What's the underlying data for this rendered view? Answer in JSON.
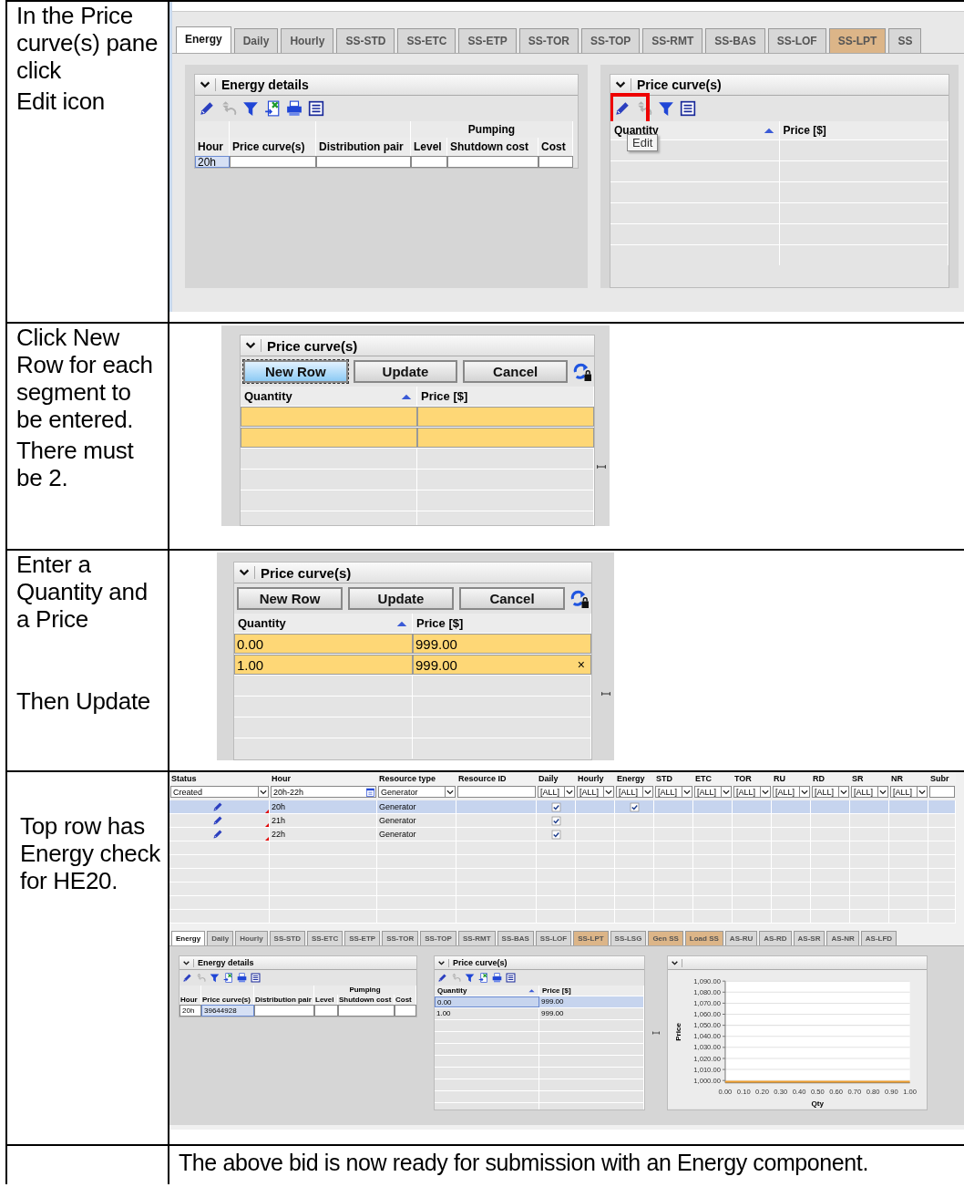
{
  "edit_step": {
    "instruction": [
      "In the Price curve(s) pane click",
      "Edit icon"
    ],
    "tabs": [
      {
        "label": "Energy",
        "selected": true,
        "highlighted": false
      },
      {
        "label": "Daily",
        "selected": false,
        "highlighted": false
      },
      {
        "label": "Hourly",
        "selected": false,
        "highlighted": false
      },
      {
        "label": "SS-STD",
        "selected": false,
        "highlighted": false
      },
      {
        "label": "SS-ETC",
        "selected": false,
        "highlighted": false
      },
      {
        "label": "SS-ETP",
        "selected": false,
        "highlighted": false
      },
      {
        "label": "SS-TOR",
        "selected": false,
        "highlighted": false
      },
      {
        "label": "SS-TOP",
        "selected": false,
        "highlighted": false
      },
      {
        "label": "SS-RMT",
        "selected": false,
        "highlighted": false
      },
      {
        "label": "SS-BAS",
        "selected": false,
        "highlighted": false
      },
      {
        "label": "SS-LOF",
        "selected": false,
        "highlighted": false
      },
      {
        "label": "SS-LPT",
        "selected": false,
        "highlighted": true
      },
      {
        "label": "SS",
        "selected": false,
        "highlighted": false
      }
    ],
    "energy_details": {
      "title": "Energy details",
      "group_header": "Pumping",
      "columns": [
        "Hour",
        "Price curve(s)",
        "Distribution pair",
        "Level",
        "Shutdown cost",
        "Cost"
      ],
      "rows": [
        {
          "cells": [
            "20h"
          ],
          "selected": true
        }
      ]
    },
    "price_curves": {
      "title": "Price curve(s)",
      "columns": [
        {
          "label": "Quantity",
          "sorted": true
        },
        {
          "label": "Price [$]",
          "sorted": false
        }
      ],
      "tooltip": "Edit",
      "edit_icon_marked": true
    }
  },
  "new_row_step": {
    "instruction": [
      "Click New Row for each segment to be entered.",
      "There must be 2."
    ],
    "panel": {
      "title": "Price curve(s)",
      "buttons": [
        {
          "label": "New Row",
          "focused": true
        },
        {
          "label": "Update",
          "focused": false
        },
        {
          "label": "Cancel",
          "focused": false
        }
      ],
      "columns": [
        {
          "label": "Quantity",
          "sorted": true
        },
        {
          "label": "Price [$]",
          "sorted": false
        }
      ],
      "rows": [
        {
          "editing": true
        },
        {
          "editing": true
        }
      ]
    }
  },
  "enter_step": {
    "instruction": [
      "Enter a Quantity and a Price",
      "Then Update"
    ],
    "panel": {
      "title": "Price curve(s)",
      "buttons": [
        {
          "label": "New Row",
          "focused": false
        },
        {
          "label": "Update",
          "focused": false
        },
        {
          "label": "Cancel",
          "focused": false
        }
      ],
      "columns": [
        {
          "label": "Quantity",
          "sorted": true
        },
        {
          "label": "Price [$]",
          "sorted": false
        }
      ],
      "rows": [
        {
          "cells": [
            "0.00",
            "999.00"
          ],
          "editing": true
        },
        {
          "cells": [
            "1.00",
            "999.00"
          ],
          "editing": true,
          "clear": "×"
        }
      ]
    }
  },
  "result_step": {
    "instruction": [
      "Top row has Energy check for HE20."
    ],
    "bid_grid": {
      "columns": [
        "Status",
        "Hour",
        "Resource type",
        "Resource ID",
        "Daily",
        "Hourly",
        "Energy",
        "STD",
        "ETC",
        "TOR",
        "RU",
        "RD",
        "SR",
        "NR",
        "Subr"
      ],
      "filters": [
        {
          "kind": "select",
          "value": "Created"
        },
        {
          "kind": "date",
          "value": "20h-22h"
        },
        {
          "kind": "select",
          "value": "Generator"
        },
        {
          "kind": "text"
        },
        {
          "kind": "select",
          "value": "[ALL]"
        },
        {
          "kind": "select",
          "value": "[ALL]"
        },
        {
          "kind": "select",
          "value": "[ALL]"
        },
        {
          "kind": "select",
          "value": "[ALL]"
        },
        {
          "kind": "select",
          "value": "[ALL]"
        },
        {
          "kind": "select",
          "value": "[ALL]"
        },
        {
          "kind": "select",
          "value": "[ALL]"
        },
        {
          "kind": "select",
          "value": "[ALL]"
        },
        {
          "kind": "select",
          "value": "[ALL]"
        },
        {
          "kind": "select",
          "value": "[ALL]"
        },
        {
          "kind": "text"
        }
      ],
      "rows": [
        {
          "hour": "20h",
          "resource_type": "Generator",
          "daily": true,
          "energy": true,
          "selected": true
        },
        {
          "hour": "21h",
          "resource_type": "Generator",
          "daily": true,
          "energy": false,
          "selected": false
        },
        {
          "hour": "22h",
          "resource_type": "Generator",
          "daily": true,
          "energy": false,
          "selected": false
        }
      ]
    },
    "tabs": [
      {
        "label": "Energy",
        "selected": true,
        "highlighted": false
      },
      {
        "label": "Daily",
        "selected": false,
        "highlighted": false
      },
      {
        "label": "Hourly",
        "selected": false,
        "highlighted": false
      },
      {
        "label": "SS-STD",
        "selected": false,
        "highlighted": false
      },
      {
        "label": "SS-ETC",
        "selected": false,
        "highlighted": false
      },
      {
        "label": "SS-ETP",
        "selected": false,
        "highlighted": false
      },
      {
        "label": "SS-TOR",
        "selected": false,
        "highlighted": false
      },
      {
        "label": "SS-TOP",
        "selected": false,
        "highlighted": false
      },
      {
        "label": "SS-RMT",
        "selected": false,
        "highlighted": false
      },
      {
        "label": "SS-BAS",
        "selected": false,
        "highlighted": false
      },
      {
        "label": "SS-LOF",
        "selected": false,
        "highlighted": false
      },
      {
        "label": "SS-LPT",
        "selected": false,
        "highlighted": true
      },
      {
        "label": "SS-LSG",
        "selected": false,
        "highlighted": false
      },
      {
        "label": "Gen SS",
        "selected": false,
        "highlighted": true
      },
      {
        "label": "Load SS",
        "selected": false,
        "highlighted": true
      },
      {
        "label": "AS-RU",
        "selected": false,
        "highlighted": false
      },
      {
        "label": "AS-RD",
        "selected": false,
        "highlighted": false
      },
      {
        "label": "AS-SR",
        "selected": false,
        "highlighted": false
      },
      {
        "label": "AS-NR",
        "selected": false,
        "highlighted": false
      },
      {
        "label": "AS-LFD",
        "selected": false,
        "highlighted": false
      }
    ],
    "energy_details": {
      "title": "Energy details",
      "group_header": "Pumping",
      "columns": [
        "Hour",
        "Price curve(s)",
        "Distribution pair",
        "Level",
        "Shutdown cost",
        "Cost"
      ],
      "rows": [
        {
          "cells": [
            "20h",
            "39644928"
          ],
          "selected": true
        }
      ]
    },
    "price_curves": {
      "title": "Price curve(s)",
      "columns": [
        {
          "label": "Quantity",
          "sorted": true
        },
        {
          "label": "Price [$]",
          "sorted": false
        }
      ],
      "rows": [
        {
          "cells": [
            "0.00",
            "999.00"
          ],
          "selected": true
        },
        {
          "cells": [
            "1.00",
            "999.00"
          ],
          "selected": false
        }
      ]
    },
    "chart_data": {
      "type": "line",
      "xlabel": "Qty",
      "ylabel": "Price",
      "x": [
        0,
        1
      ],
      "series": [
        {
          "color": "#f0a030",
          "values": [
            999,
            999
          ]
        }
      ],
      "xlim": [
        0,
        1
      ],
      "ylim": [
        998,
        1090
      ],
      "grid": true,
      "xticks": [
        {
          "value": 0,
          "label": "0.00"
        },
        {
          "value": 0.1,
          "label": "0.10"
        },
        {
          "value": 0.2,
          "label": "0.20"
        },
        {
          "value": 0.3,
          "label": "0.30"
        },
        {
          "value": 0.4,
          "label": "0.40"
        },
        {
          "value": 0.5,
          "label": "0.50"
        },
        {
          "value": 0.6,
          "label": "0.60"
        },
        {
          "value": 0.7,
          "label": "0.70"
        },
        {
          "value": 0.8,
          "label": "0.80"
        },
        {
          "value": 0.9,
          "label": "0.90"
        },
        {
          "value": 1,
          "label": "1.00"
        }
      ],
      "yticks": [
        {
          "value": 1000,
          "label": "1,000.00"
        },
        {
          "value": 1010,
          "label": "1,010.00"
        },
        {
          "value": 1020,
          "label": "1,020.00"
        },
        {
          "value": 1030,
          "label": "1,030.00"
        },
        {
          "value": 1040,
          "label": "1,040.00"
        },
        {
          "value": 1050,
          "label": "1,050.00"
        },
        {
          "value": 1060,
          "label": "1,060.00"
        },
        {
          "value": 1070,
          "label": "1,070.00"
        },
        {
          "value": 1080,
          "label": "1,080.00"
        },
        {
          "value": 1090,
          "label": "1,090.00"
        }
      ]
    }
  },
  "closing_note": "The above bid is now ready for submission with an Energy component."
}
